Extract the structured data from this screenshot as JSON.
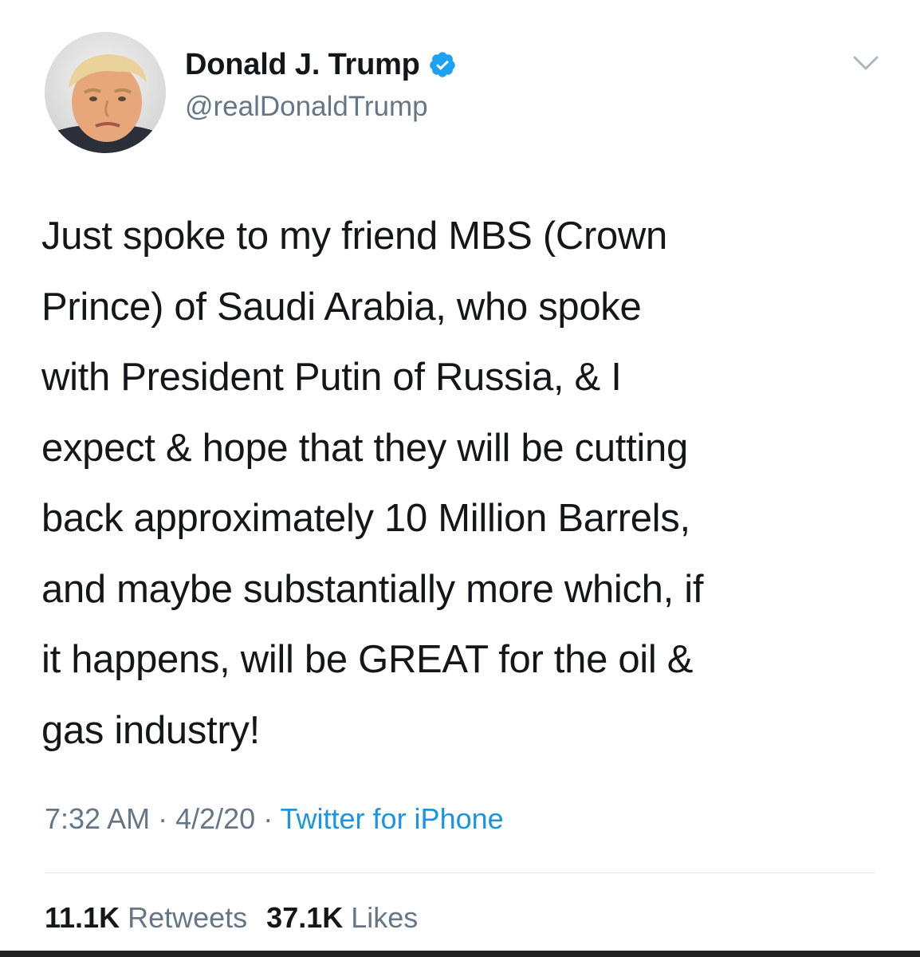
{
  "author": {
    "display_name": "Donald J. Trump",
    "handle": "@realDonaldTrump",
    "verified": true
  },
  "tweet": {
    "text": "Just spoke to my friend MBS (Crown\nPrince) of Saudi Arabia, who spoke\nwith President Putin of Russia, & I\nexpect & hope that they will be cutting\nback approximately 10 Million Barrels,\nand maybe substantially more which, if\nit happens, will be GREAT for the oil &\ngas industry!"
  },
  "meta": {
    "time": "7:32 AM",
    "separator": " · ",
    "date": "4/2/20",
    "source": "Twitter for iPhone"
  },
  "stats": {
    "retweets_count": "11.1K",
    "retweets_label": "Retweets",
    "likes_count": "37.1K",
    "likes_label": "Likes"
  },
  "icons": {
    "verified": "verified-badge-icon",
    "caret": "chevron-down-icon"
  },
  "colors": {
    "text_primary": "#14171a",
    "text_secondary": "#657786",
    "link": "#1b95e0",
    "verified": "#1da1f2",
    "divider": "#e1e8ed"
  }
}
